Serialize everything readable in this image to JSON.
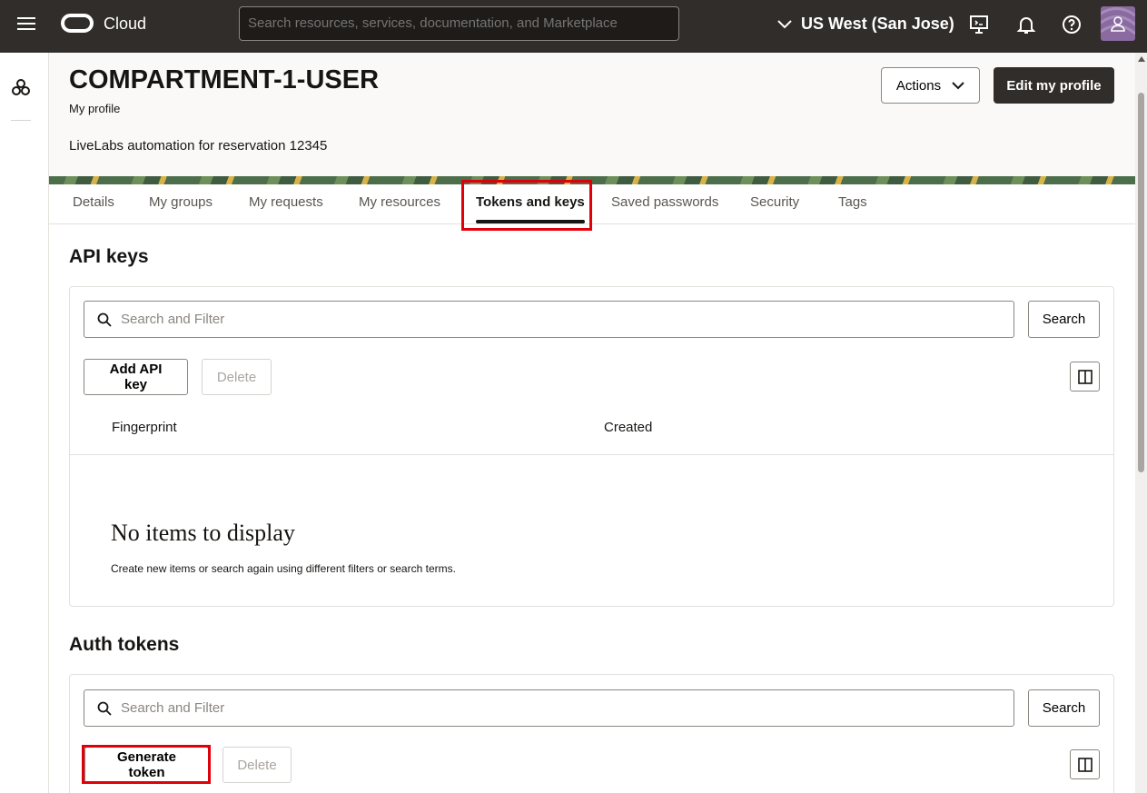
{
  "topbar": {
    "brand": "Cloud",
    "search_placeholder": "Search resources, services, documentation, and Marketplace",
    "region": "US West (San Jose)"
  },
  "header": {
    "title": "COMPARTMENT-1-USER",
    "subtitle": "My profile",
    "description": "LiveLabs automation for reservation 12345",
    "actions_label": "Actions",
    "edit_label": "Edit my profile"
  },
  "tabs": [
    "Details",
    "My groups",
    "My requests",
    "My resources",
    "Tokens and keys",
    "Saved passwords",
    "Security",
    "Tags"
  ],
  "active_tab": "Tokens and keys",
  "api_keys": {
    "title": "API keys",
    "filter_placeholder": "Search and Filter",
    "search_label": "Search",
    "add_label": "Add API key",
    "delete_label": "Delete",
    "columns": [
      "Fingerprint",
      "Created"
    ],
    "empty_title": "No items to display",
    "empty_subtitle": "Create new items or search again using different filters or search terms."
  },
  "auth_tokens": {
    "title": "Auth tokens",
    "filter_placeholder": "Search and Filter",
    "search_label": "Search",
    "generate_label": "Generate token",
    "delete_label": "Delete"
  },
  "colors": {
    "topbar": "#312d2a",
    "highlight": "#e0000a",
    "primary_button": "#312d2a"
  },
  "icons": [
    "hamburger-menu-icon",
    "oracle-logo-icon",
    "chevron-down-icon",
    "cloud-shell-icon",
    "bell-icon",
    "help-icon",
    "user-icon",
    "resource-tree-icon",
    "search-icon",
    "columns-icon"
  ]
}
